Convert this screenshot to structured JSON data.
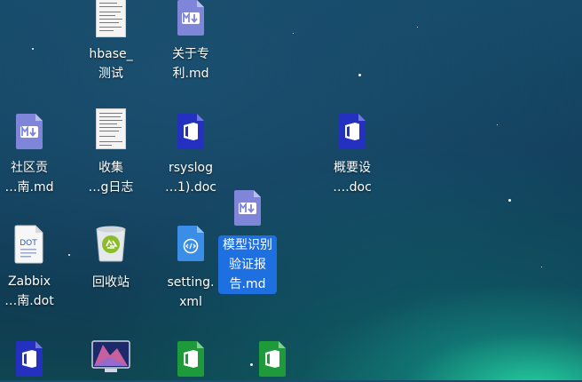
{
  "colors": {
    "md_icon": "#7f85d8",
    "office_blue": "#2431c0",
    "office_green": "#1f9a3a",
    "selection": "#1e6fe0"
  },
  "items": [
    {
      "name": "hbase-file",
      "label": "hbase_\n测试",
      "icon": "document-thumbnail-icon"
    },
    {
      "name": "patent-md",
      "label": "关于专\n利.md",
      "icon": "markdown-icon"
    },
    {
      "name": "community-md",
      "label": "社区贡\n…南.md",
      "icon": "markdown-icon"
    },
    {
      "name": "collect-log",
      "label": "收集\n…g日志",
      "icon": "document-thumbnail-icon"
    },
    {
      "name": "rsyslog-doc",
      "label": "rsyslog\n…1).doc",
      "icon": "office-doc-icon"
    },
    {
      "name": "overview-doc",
      "label": "概要设\n….doc",
      "icon": "office-doc-icon"
    },
    {
      "name": "model-md",
      "label": "模型识别\n验证报\n告.md",
      "icon": "markdown-icon"
    },
    {
      "name": "zabbix-dot",
      "label": "Zabbix\n…南.dot",
      "icon": "dot-template-icon"
    },
    {
      "name": "recycle-bin",
      "label": "回收站",
      "icon": "recycle-bin-icon"
    },
    {
      "name": "setting-xml",
      "label": "setting.\nxml",
      "icon": "xml-file-icon"
    },
    {
      "name": "bottom-doc",
      "label": "",
      "icon": "office-doc-icon"
    },
    {
      "name": "bottom-display",
      "label": "",
      "icon": "display-settings-icon"
    },
    {
      "name": "bottom-sheet-1",
      "label": "",
      "icon": "office-sheet-icon"
    },
    {
      "name": "bottom-sheet-2",
      "label": "",
      "icon": "office-sheet-icon"
    }
  ]
}
